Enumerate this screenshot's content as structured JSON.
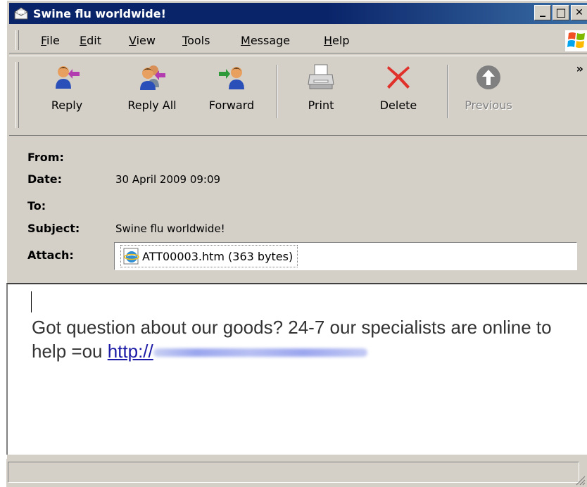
{
  "window": {
    "title": "Swine flu worldwide!"
  },
  "title_buttons": {
    "minimize": "_",
    "maximize": "□",
    "close": "✕"
  },
  "menu": [
    "File",
    "Edit",
    "View",
    "Tools",
    "Message",
    "Help"
  ],
  "menu_mnemonics": [
    "F",
    "E",
    "V",
    "T",
    "M",
    "H"
  ],
  "toolbar": {
    "reply": "Reply",
    "reply_all": "Reply All",
    "forward": "Forward",
    "print": "Print",
    "delete": "Delete",
    "previous": "Previous",
    "overflow": "»"
  },
  "header": {
    "from_label": "From:",
    "from_value": "",
    "date_label": "Date:",
    "date_value": "30 April 2009 09:09",
    "to_label": "To:",
    "to_value": "",
    "subject_label": "Subject:",
    "subject_value": "Swine flu worldwide!",
    "attach_label": "Attach:",
    "attachment": "ATT00003.htm (363 bytes)"
  },
  "body": {
    "text": "Got question about our goods? 24-7 our specialists are online to help =ou ",
    "link_text": "http://"
  },
  "icons": {
    "title": "envelope-icon",
    "reply": "reply-icon",
    "reply_all": "reply-all-icon",
    "forward": "forward-icon",
    "print": "printer-icon",
    "delete": "delete-x-icon",
    "previous": "up-arrow-icon",
    "attachment": "html-file-icon",
    "logo": "windows-logo-icon"
  },
  "colors": {
    "titlebar": "#0a246a",
    "chrome": "#d4d0c8",
    "link": "#1a1aa6",
    "delete_red": "#e0312b"
  }
}
